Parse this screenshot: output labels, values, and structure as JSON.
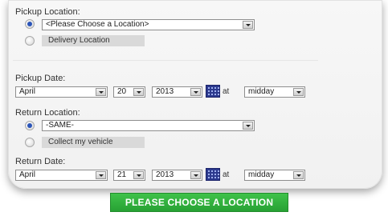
{
  "pickup": {
    "label": "Pickup Location:",
    "location_select": "<Please Choose a Location>",
    "delivery_option": "Delivery Location"
  },
  "pickup_date": {
    "label": "Pickup Date:",
    "month": "April",
    "day": "20",
    "year": "2013",
    "at": "at",
    "time": "midday"
  },
  "return": {
    "label": "Return Location:",
    "location_select": "-SAME-",
    "collect_option": "Collect my vehicle"
  },
  "return_date": {
    "label": "Return Date:",
    "month": "April",
    "day": "21",
    "year": "2013",
    "at": "at",
    "time": "midday"
  },
  "submit_label": "PLEASE CHOOSE A LOCATION",
  "colors": {
    "accent_green": "#2fae3b",
    "radio_selected": "#2b55b8"
  }
}
